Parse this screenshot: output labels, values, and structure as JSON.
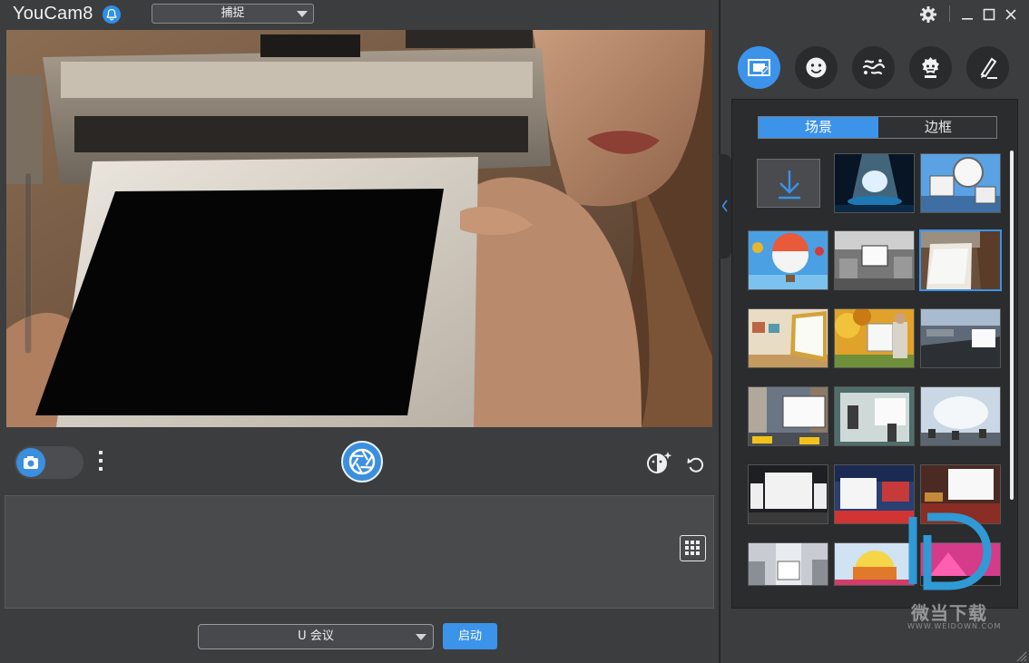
{
  "titlebar": {
    "app_name": "YouCam",
    "app_version": "8",
    "mode_value": "捕捉",
    "icons": [
      "bell-icon",
      "settings-gear-icon",
      "minimize-icon",
      "maximize-icon",
      "close-icon"
    ]
  },
  "controls": {
    "icons": [
      "camera-icon",
      "more-vertical-icon",
      "shutter-icon",
      "face-effect-icon",
      "rotate-icon",
      "grid-icon"
    ]
  },
  "meeting": {
    "select_value": "U 会议",
    "start_label": "启动"
  },
  "panel": {
    "categories": [
      {
        "name": "scene-frame-icon",
        "active": true
      },
      {
        "name": "emoji-face-icon",
        "active": false
      },
      {
        "name": "particle-effect-icon",
        "active": false
      },
      {
        "name": "avatar-mask-icon",
        "active": false
      },
      {
        "name": "brush-draw-icon",
        "active": false
      }
    ],
    "tabs": [
      {
        "label": "场景",
        "active": true
      },
      {
        "label": "边框",
        "active": false
      }
    ],
    "selected_index": 5
  },
  "watermark": {
    "text": "微当下载",
    "url": "WWW.WEIDOWN.COM"
  },
  "colors": {
    "accent": "#3b93ea",
    "background": "#3c3d3f",
    "panel": "#2b2c2e"
  }
}
